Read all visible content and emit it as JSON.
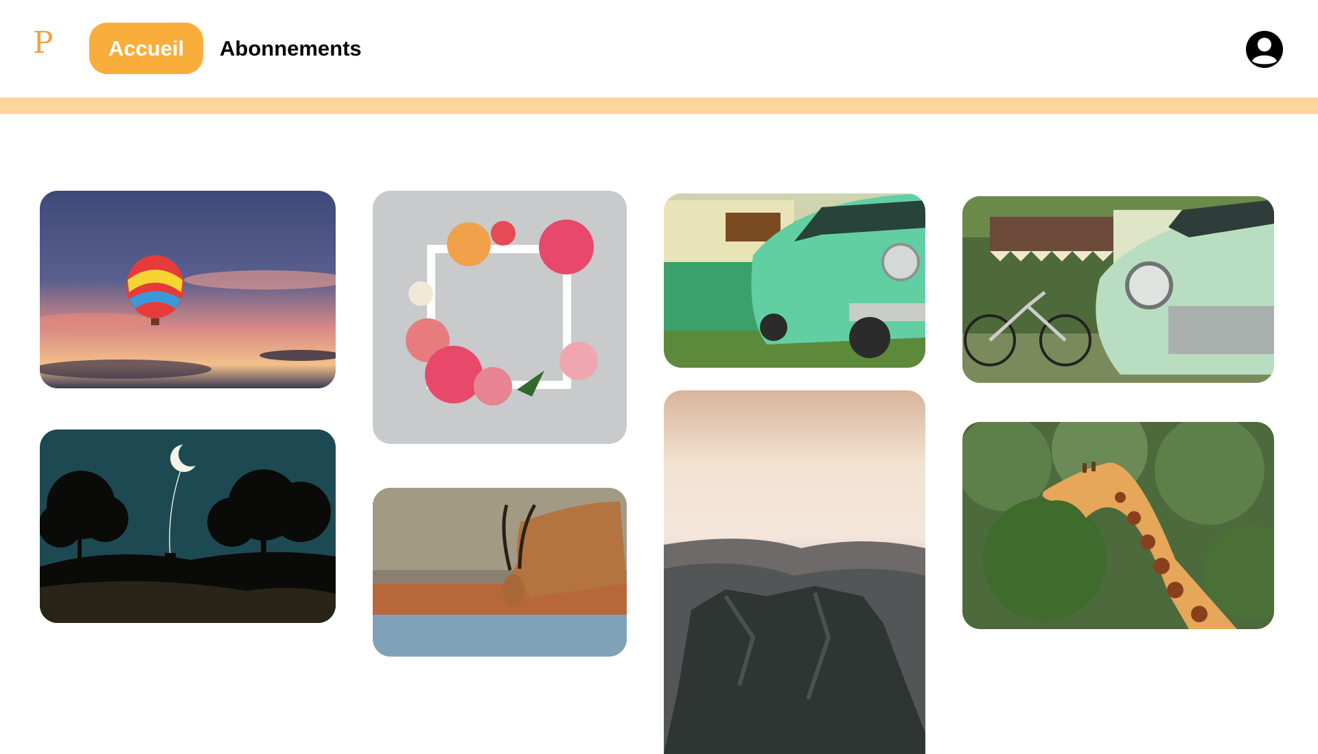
{
  "header": {
    "logo": "P",
    "nav": {
      "home_label": "Accueil",
      "subscriptions_label": "Abonnements"
    }
  },
  "colors": {
    "accent": "#f9ae3c",
    "stripe": "#ffd499",
    "logo": "#f0a43a"
  },
  "gallery": {
    "images": [
      {
        "name": "hot-air-balloon-sunset"
      },
      {
        "name": "flower-frame"
      },
      {
        "name": "green-classic-car-and-caravan"
      },
      {
        "name": "mint-classic-car-with-bicycle"
      },
      {
        "name": "moon-night-trees"
      },
      {
        "name": "antelope-drinking"
      },
      {
        "name": "mountain-sunrise-cliffs"
      },
      {
        "name": "giraffe-forest"
      }
    ]
  }
}
